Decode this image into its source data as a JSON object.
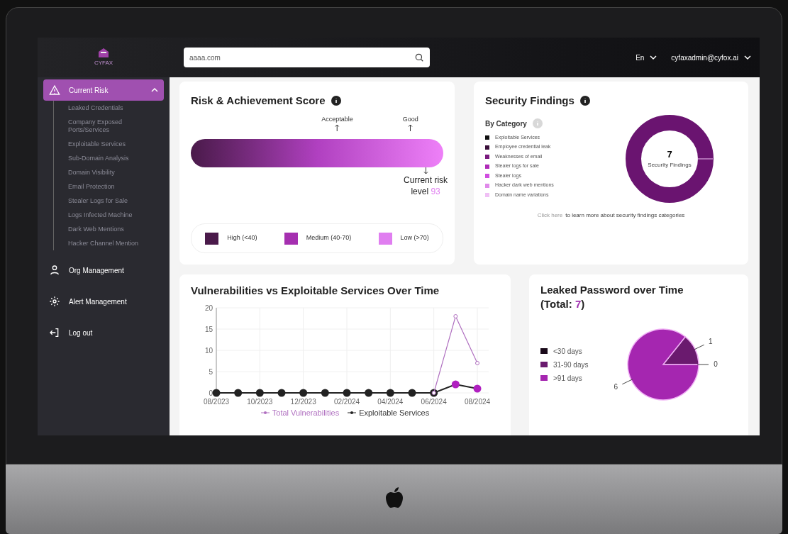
{
  "sidebar": {
    "logo_text": "CYFAX",
    "items": [
      {
        "label": "Current Risk",
        "kind": "alert",
        "expanded": true,
        "selected": true,
        "children": [
          {
            "label": "Leaked Credentials"
          },
          {
            "label": "Company Exposed Ports/Services"
          },
          {
            "label": "Exploitable Services"
          },
          {
            "label": "Sub-Domain Analysis"
          },
          {
            "label": "Domain Visibility"
          },
          {
            "label": "Email Protection"
          },
          {
            "label": "Stealer Logs for Sale"
          },
          {
            "label": "Logs Infected Machine"
          },
          {
            "label": "Dark Web Mentions"
          },
          {
            "label": "Hacker Channel Mention"
          }
        ]
      },
      {
        "label": "Org Management",
        "kind": "user",
        "selected": false
      },
      {
        "label": "Alert Management",
        "kind": "sun",
        "selected": false
      },
      {
        "label": "Log out",
        "kind": "logout",
        "selected": false
      }
    ]
  },
  "header": {
    "search": {
      "value": "aaaa.com"
    },
    "language": "En",
    "account": "cyfaxadmin@cyfox.ai"
  },
  "risk_card": {
    "title": "Risk & Achievement Score",
    "markers": [
      {
        "label": "Acceptable",
        "level": 0.58
      },
      {
        "label": "Good",
        "level": 0.87
      }
    ],
    "current": {
      "label": "Current risk",
      "prefix": "level",
      "value": "93",
      "level": 0.93
    },
    "legend": [
      {
        "label": "High (<40)",
        "color": "#4a1a4a"
      },
      {
        "label": "Medium (40-70)",
        "color": "#a52fb0"
      },
      {
        "label": "Low (>70)",
        "color": "#e07ef0"
      }
    ]
  },
  "findings_card": {
    "title": "Security Findings",
    "subtitle": "By Category",
    "categories": [
      {
        "label": "Exploitable Services",
        "color": "#111111"
      },
      {
        "label": "Employee credential leak",
        "color": "#3a0f3a"
      },
      {
        "label": "Weaknesses of email",
        "color": "#7a1a7e"
      },
      {
        "label": "Stealer logs for sale",
        "color": "#b02bb8"
      },
      {
        "label": "Stealer logs",
        "color": "#d04ee0"
      },
      {
        "label": "Hacker dark web mentions",
        "color": "#e08aea"
      },
      {
        "label": "Domain name variations",
        "color": "#f0c0f5"
      }
    ],
    "total": "7",
    "total_label": "Security Findings",
    "link": "Click here",
    "note": "to learn more about security findings categories"
  },
  "vuln_card": {
    "title": "Vulnerabilities vs Exploitable Services Over Time",
    "chart_data": {
      "type": "line",
      "categories": [
        "08/2023",
        null,
        "10/2023",
        null,
        "12/2023",
        null,
        "02/2024",
        null,
        "04/2024",
        null,
        "06/2024",
        null,
        "08/2024"
      ],
      "yticks": [
        0,
        5,
        10,
        15,
        20
      ],
      "ylim": [
        0,
        20
      ],
      "grid": true,
      "legend": true,
      "series": [
        {
          "name": "Total Vulnerabilities",
          "color": "#b070c0",
          "marker": "circle",
          "values": [
            null,
            null,
            null,
            null,
            null,
            null,
            null,
            null,
            null,
            null,
            0,
            18,
            7
          ]
        },
        {
          "name": "Exploitable Services",
          "color": "#222222",
          "marker": "circle",
          "values": [
            0,
            0,
            0,
            0,
            0,
            0,
            0,
            0,
            0,
            0,
            0,
            2,
            1
          ]
        }
      ]
    }
  },
  "leaked_card": {
    "title": "Leaked Password over Time",
    "total_prefix": "(Total: ",
    "total": "7",
    "total_suffix": ")",
    "chart_data": {
      "type": "pie",
      "categories": [
        "<30 days",
        "31-90 days",
        ">91 days"
      ],
      "series": [
        {
          "values": [
            0,
            1,
            6
          ]
        }
      ],
      "colors": [
        "#1a0a1a",
        "#6a1a6e",
        "#a526b0"
      ],
      "data_labels": true,
      "annotations": [
        {
          "text": "0"
        }
      ],
      "legend": true
    }
  }
}
